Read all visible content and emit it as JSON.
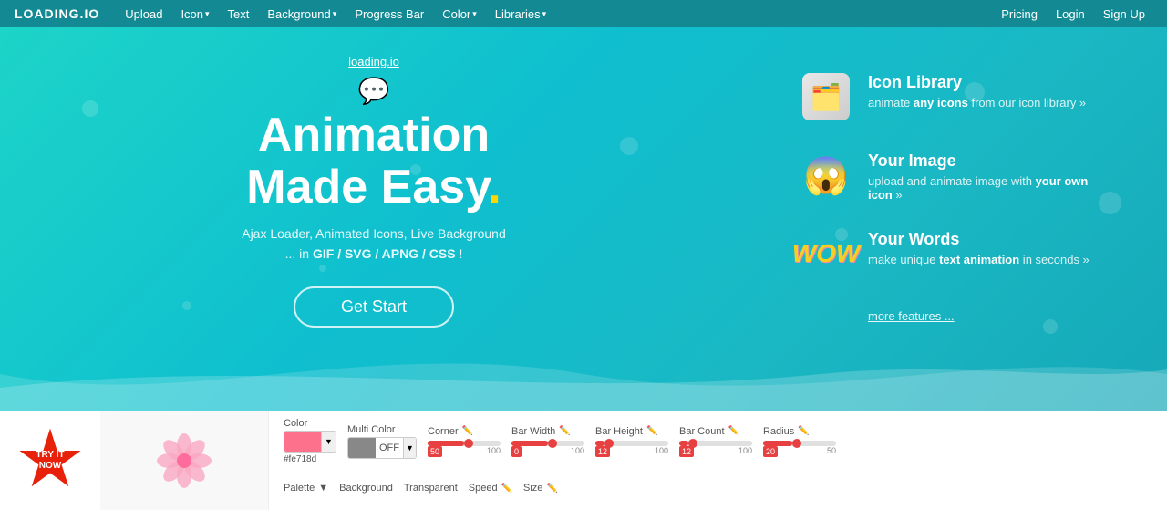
{
  "brand": "LOADING.IO",
  "nav": {
    "left": [
      {
        "label": "Upload",
        "hasArrow": false
      },
      {
        "label": "Icon",
        "hasArrow": true
      },
      {
        "label": "Text",
        "hasArrow": false
      },
      {
        "label": "Background",
        "hasArrow": true
      },
      {
        "label": "Progress Bar",
        "hasArrow": false
      },
      {
        "label": "Color",
        "hasArrow": true
      },
      {
        "label": "Libraries",
        "hasArrow": true
      }
    ],
    "right": [
      {
        "label": "Pricing"
      },
      {
        "label": "Login"
      },
      {
        "label": "Sign Up"
      }
    ]
  },
  "hero": {
    "link": "loading.io",
    "title_line1": "Animation",
    "title_line2": "Made Easy.",
    "subtitle": "Ajax Loader, Animated Icons, Live Background",
    "formats": "... in GIF / SVG / APNG / CSS !",
    "cta": "Get Start"
  },
  "features": [
    {
      "id": "icon-library",
      "title": "Icon Library",
      "desc_before": "animate ",
      "desc_bold": "any icons",
      "desc_after": " from our icon library »"
    },
    {
      "id": "your-image",
      "title": "Your Image",
      "desc_before": "upload and animate image with ",
      "desc_bold": "your own icon",
      "desc_after": " »"
    },
    {
      "id": "your-words",
      "title": "Your Words",
      "desc_before": "make unique ",
      "desc_bold": "text animation",
      "desc_after": " in seconds »"
    }
  ],
  "more_features": "more features ...",
  "try_badge": "TRY IT\nNOW",
  "controls": {
    "row1": [
      {
        "type": "color",
        "label": "Color",
        "value": "#fe718d",
        "swatch_color": "#fe718d"
      },
      {
        "type": "toggle",
        "label": "Multi Color",
        "value": "OFF"
      },
      {
        "type": "slider",
        "label": "Corner",
        "hasEdit": true,
        "value": 50,
        "min": 0,
        "max": 100,
        "fill_pct": 50
      },
      {
        "type": "slider",
        "label": "Bar Width",
        "hasEdit": true,
        "value": 50,
        "min": 0,
        "max": 100,
        "fill_pct": 50
      },
      {
        "type": "slider",
        "label": "Bar Height",
        "hasEdit": true,
        "value": 12,
        "min": 0,
        "max": 100,
        "fill_pct": 12
      },
      {
        "type": "slider",
        "label": "Bar Count",
        "hasEdit": true,
        "value": 12,
        "min": 0,
        "max": 100,
        "fill_pct": 12
      },
      {
        "type": "slider",
        "label": "Radius",
        "hasEdit": true,
        "value": 20,
        "min": 0,
        "max": 50,
        "fill_pct": 40
      }
    ],
    "row2": [
      {
        "label": "Palette",
        "hasArrow": true
      },
      {
        "label": "Background",
        "hasEdit": false
      },
      {
        "label": "Transparent",
        "hasEdit": false
      },
      {
        "label": "Speed",
        "hasEdit": true
      },
      {
        "label": "Size",
        "hasEdit": true
      }
    ]
  }
}
